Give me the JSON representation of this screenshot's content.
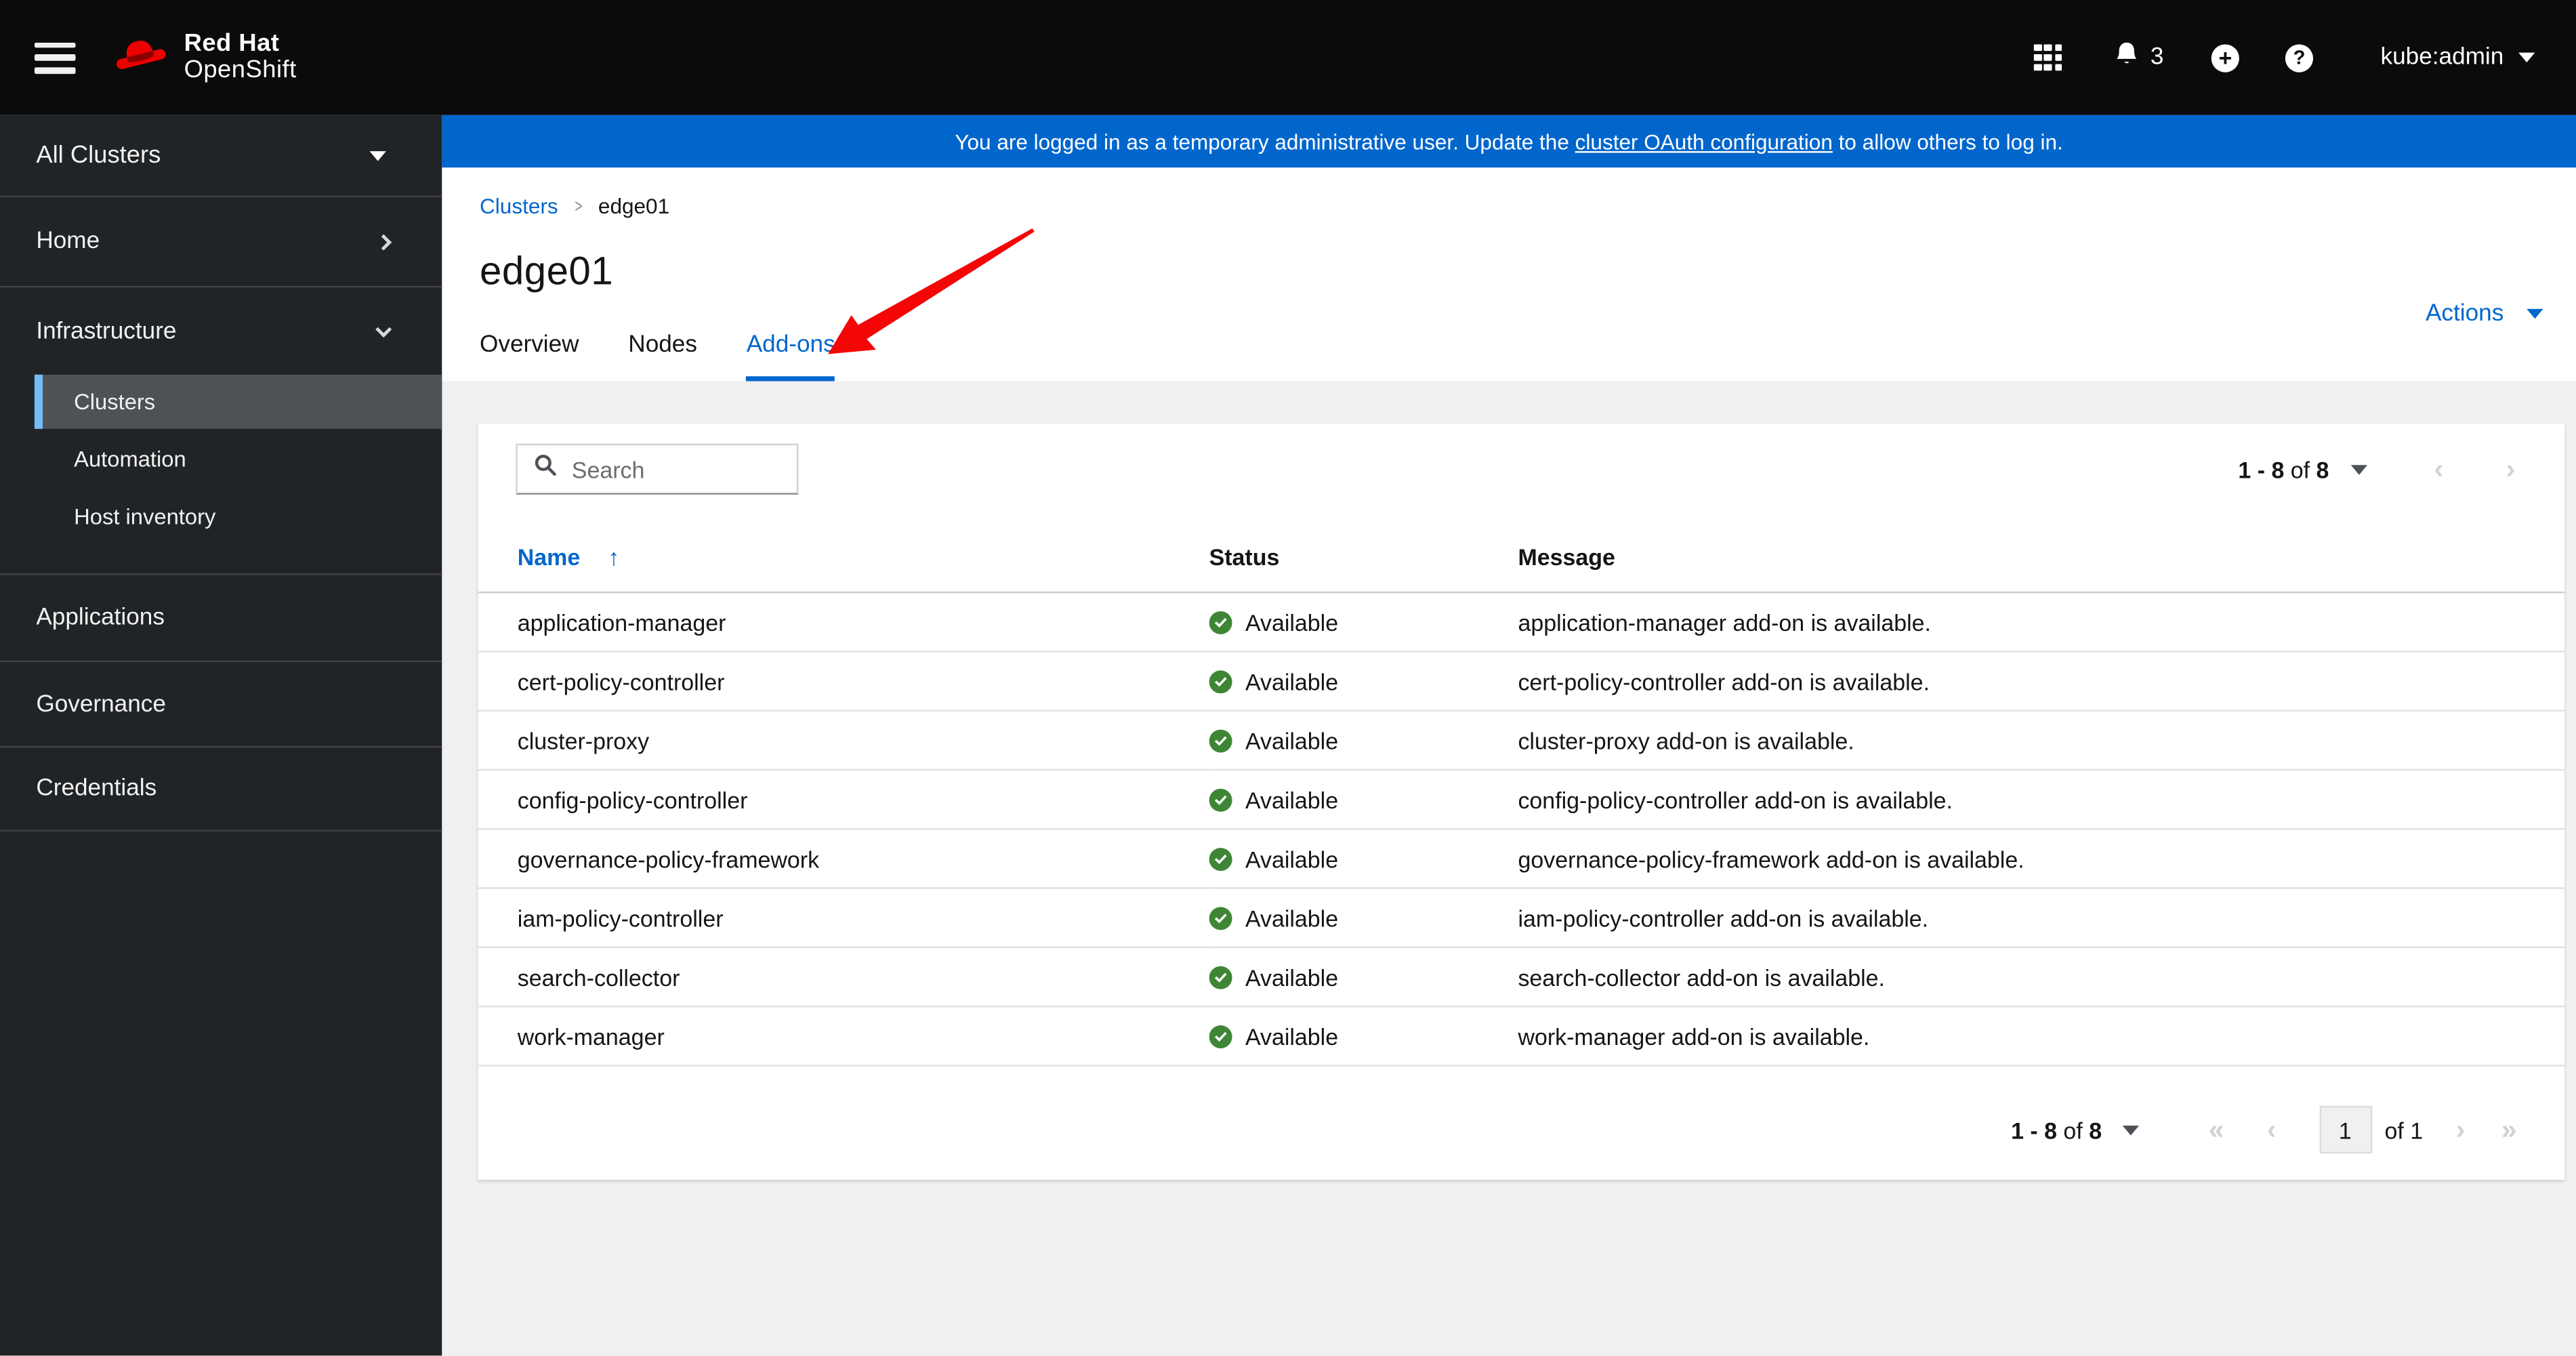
{
  "colors": {
    "accent_blue": "#0066cc",
    "banner_bg": "#0066cc",
    "success_green": "#3e8635",
    "nav_selected_border": "#73bcf7",
    "brand_red": "#ee0000",
    "annotation_arrow_red": "#f40606"
  },
  "masthead": {
    "brand_line1": "Red Hat",
    "brand_line2": "OpenShift",
    "notification_count": "3",
    "plus_glyph": "+",
    "help_glyph": "?",
    "user_menu": "kube:admin"
  },
  "banner": {
    "text_before": "You are logged in as a temporary administrative user. Update the ",
    "link_text": "cluster OAuth configuration",
    "text_after": " to allow others to log in."
  },
  "sidebar": {
    "cluster_selector_label": "All Clusters",
    "home_label": "Home",
    "infrastructure_label": "Infrastructure",
    "infrastructure_children": [
      "Clusters",
      "Automation",
      "Host inventory"
    ],
    "selected_child": "Clusters",
    "applications_label": "Applications",
    "governance_label": "Governance",
    "credentials_label": "Credentials"
  },
  "breadcrumb": {
    "items": [
      "Clusters",
      "edge01"
    ]
  },
  "page": {
    "title": "edge01",
    "actions_label": "Actions"
  },
  "tabs": [
    {
      "label": "Overview",
      "selected": false
    },
    {
      "label": "Nodes",
      "selected": false
    },
    {
      "label": "Add-ons",
      "selected": true
    }
  ],
  "toolbar": {
    "search_placeholder": "Search"
  },
  "pagination_top": {
    "range": "1 - 8",
    "of": "of",
    "total": "8"
  },
  "table": {
    "columns": [
      "Name",
      "Status",
      "Message"
    ],
    "sorted_by": "Name",
    "sort_direction": "ascending",
    "sort_glyph": "↑",
    "rows": [
      {
        "name": "application-manager",
        "status": "Available",
        "message": "application-manager add-on is available."
      },
      {
        "name": "cert-policy-controller",
        "status": "Available",
        "message": "cert-policy-controller add-on is available."
      },
      {
        "name": "cluster-proxy",
        "status": "Available",
        "message": "cluster-proxy add-on is available."
      },
      {
        "name": "config-policy-controller",
        "status": "Available",
        "message": "config-policy-controller add-on is available."
      },
      {
        "name": "governance-policy-framework",
        "status": "Available",
        "message": "governance-policy-framework add-on is available."
      },
      {
        "name": "iam-policy-controller",
        "status": "Available",
        "message": "iam-policy-controller add-on is available."
      },
      {
        "name": "search-collector",
        "status": "Available",
        "message": "search-collector add-on is available."
      },
      {
        "name": "work-manager",
        "status": "Available",
        "message": "work-manager add-on is available."
      }
    ]
  },
  "pagination_bottom": {
    "range": "1 - 8",
    "of": "of",
    "total": "8",
    "first_glyph": "«",
    "prev_glyph": "‹",
    "current_page": "1",
    "of_pages": "of 1",
    "next_glyph": "›",
    "last_glyph": "»"
  }
}
